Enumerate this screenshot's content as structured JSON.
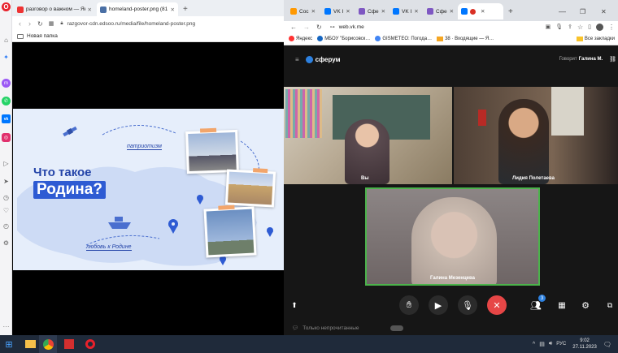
{
  "opera": {
    "tabs": [
      {
        "label": "разговор о важном — Ян…",
        "color": "#e33"
      },
      {
        "label": "homeland-poster.png (81…",
        "color": "#4a6fa5"
      }
    ],
    "new_tab": "+",
    "url": "razgovor-cdn.edsoo.ru/media/file/homeland-poster.png",
    "bookmark_folder": "Новая папка"
  },
  "poster": {
    "title_line1": "Что такое",
    "title_line2": "Родина?",
    "caption_patriotism": "патриотизм",
    "caption_love": "любовь к Родине"
  },
  "chrome": {
    "tabs": [
      {
        "label": "Сос",
        "color": "#ff9800"
      },
      {
        "label": "VK I",
        "color": "#0077ff"
      },
      {
        "label": "Сфе",
        "color": "#7e57c2"
      },
      {
        "label": "VK I",
        "color": "#0077ff"
      },
      {
        "label": "Сфе",
        "color": "#7e57c2"
      },
      {
        "label": "",
        "color": "#0077ff"
      }
    ],
    "url": "web.vk.me",
    "bookmarks": [
      {
        "label": "Яндекс",
        "color": "#f33"
      },
      {
        "label": "МБОУ \"Борисовск…",
        "color": "#1565c0"
      },
      {
        "label": "GISMETEO: Погода…",
        "color": "#4285f4"
      },
      {
        "label": "38 · Входящие — Я…",
        "color": "#f5a623"
      },
      {
        "label": "Все закладки",
        "color": "#f9c32b"
      }
    ]
  },
  "vk": {
    "app_name": "сферум",
    "speaking_prefix": "Говорит",
    "speaking_name": "Галина М.",
    "participants": [
      {
        "name": "Вы"
      },
      {
        "name": "Лидия Полетаева"
      },
      {
        "name": "Галина Мезенцева"
      }
    ],
    "participants_badge": "3",
    "footer_text": "Только непрочитанные"
  },
  "taskbar": {
    "lang": "РУС",
    "time": "9:02",
    "date": "27.11.2023"
  }
}
